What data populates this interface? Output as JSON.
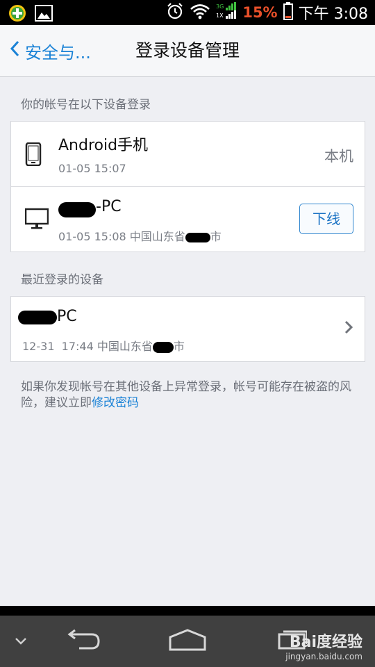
{
  "status_bar": {
    "network": "3G 1X",
    "battery_pct": "15%",
    "time": "下午 3:08"
  },
  "header": {
    "back_label": "安全与...",
    "title": "登录设备管理"
  },
  "logged_in": {
    "section_label": "你的帐号在以下设备登录",
    "devices": [
      {
        "name": "Android手机",
        "meta": "01-05 15:07",
        "tag": "本机"
      },
      {
        "name": "-PC",
        "meta": "01-05 15:08 中国山东省",
        "meta_suffix": "市",
        "action": "下线"
      }
    ]
  },
  "recent": {
    "section_label": "最近登录的设备",
    "devices": [
      {
        "name": "PC",
        "date": "12-31",
        "time": "17:44",
        "location": "中国山东省",
        "location_suffix": "市"
      }
    ]
  },
  "warning": {
    "text": "如果你发现帐号在其他设备上异常登录，帐号可能存在被盗的风险，建议立即",
    "link": "修改密码"
  },
  "watermark": {
    "main": "Bai度经验",
    "sub": "jingyan.baidu.com"
  },
  "colors": {
    "accent": "#1a82d6",
    "battery_low": "#e8502a"
  }
}
